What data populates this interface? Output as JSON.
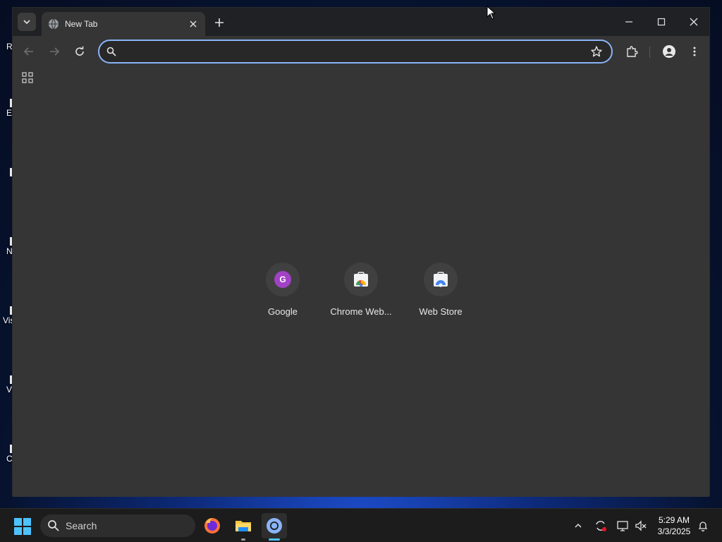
{
  "desktop": {
    "icons": [
      {
        "label": "R"
      },
      {
        "label": "E"
      },
      {
        "label": ""
      },
      {
        "label": "N"
      },
      {
        "label": "Vis"
      },
      {
        "label": "V"
      },
      {
        "label": "C"
      }
    ]
  },
  "browser": {
    "tab": {
      "title": "New Tab"
    },
    "omnibox": {
      "value": "",
      "placeholder": ""
    },
    "shortcuts": [
      {
        "label": "Google",
        "icon": "google-g-icon"
      },
      {
        "label": "Chrome Web...",
        "icon": "chrome-web-store-icon"
      },
      {
        "label": "Web Store",
        "icon": "chrome-web-store-icon"
      }
    ],
    "colors": {
      "accent": "#8ab4f8",
      "background": "#353535",
      "titlebar": "#202124"
    }
  },
  "taskbar": {
    "search_label": "Search",
    "apps": [
      "firefox-icon",
      "file-explorer-icon",
      "chrome-icon"
    ],
    "clock": {
      "time": "5:29 AM",
      "date": "3/3/2025"
    }
  }
}
